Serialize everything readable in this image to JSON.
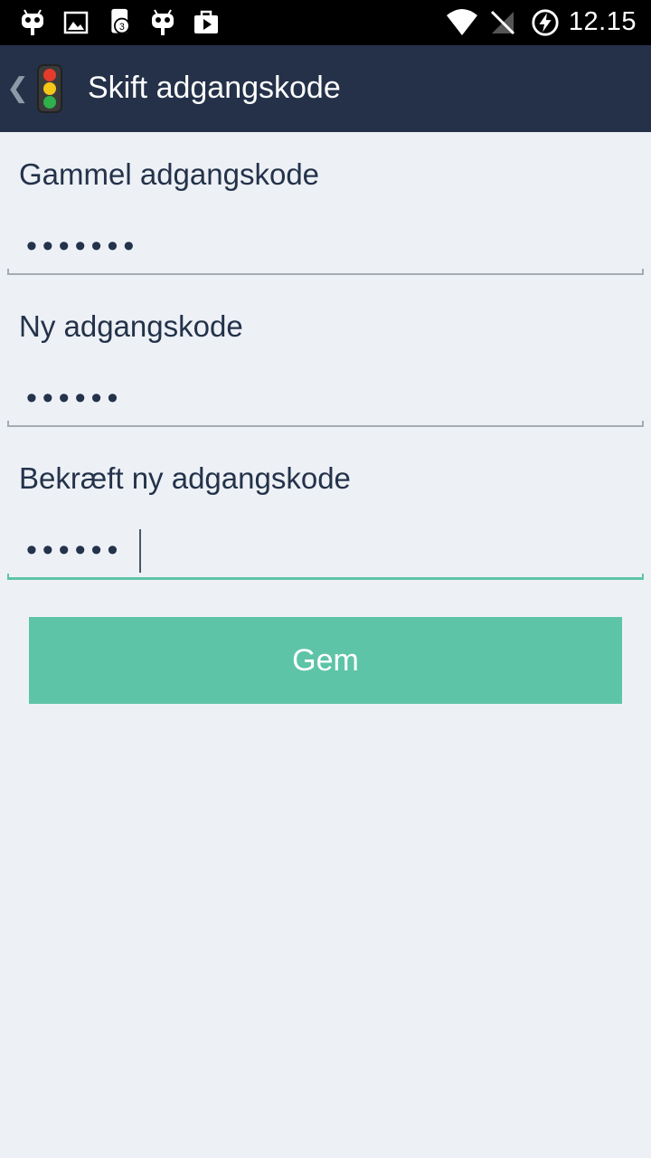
{
  "status_bar": {
    "time": "12.15",
    "notification_badge": "3",
    "left_icons": [
      "android-icon",
      "image-icon",
      "phone-badge-icon",
      "android-icon",
      "play-store-icon"
    ],
    "right_icons": [
      "wifi-icon",
      "no-signal-icon",
      "battery-charging-icon"
    ]
  },
  "action_bar": {
    "title": "Skift adgangskode",
    "back_icon": "chevron-left-icon",
    "app_icon": "traffic-light-icon"
  },
  "form": {
    "old_password": {
      "label": "Gammel adgangskode",
      "value": "•••••••"
    },
    "new_password": {
      "label": "Ny adgangskode",
      "value": "••••••"
    },
    "confirm_password": {
      "label": "Bekræft ny adgangskode",
      "value": "••••••"
    },
    "save_label": "Gem"
  },
  "colors": {
    "action_bar": "#243149",
    "background": "#edf1f6",
    "accent": "#5ec4a7",
    "text": "#24324a"
  }
}
